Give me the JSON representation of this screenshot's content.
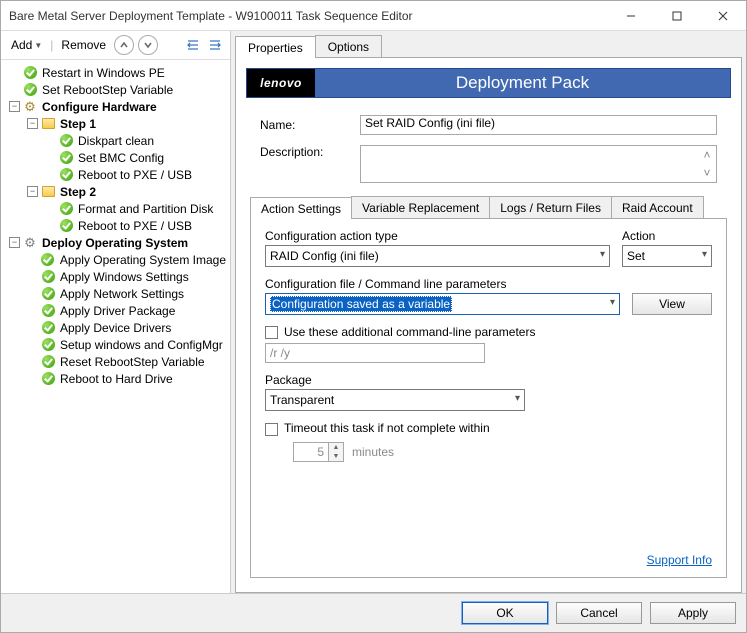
{
  "window": {
    "title": "Bare Metal Server Deployment Template - W9100011 Task Sequence Editor"
  },
  "toolbar": {
    "add": "Add",
    "remove": "Remove"
  },
  "tree": [
    {
      "indent": 0,
      "icon": "check",
      "label": "Restart in Windows PE"
    },
    {
      "indent": 0,
      "icon": "check",
      "label": "Set RebootStep Variable"
    },
    {
      "indent": 0,
      "icon": "gear",
      "label": "Configure Hardware",
      "bold": true,
      "toggle": "-"
    },
    {
      "indent": 1,
      "icon": "folder",
      "label": "Step 1",
      "bold": true,
      "toggle": "-"
    },
    {
      "indent": 2,
      "icon": "check",
      "label": "Diskpart clean"
    },
    {
      "indent": 2,
      "icon": "check",
      "label": "Set BMC Config"
    },
    {
      "indent": 2,
      "icon": "check",
      "label": "Reboot to PXE / USB"
    },
    {
      "indent": 1,
      "icon": "folder",
      "label": "Step 2",
      "bold": true,
      "toggle": "-"
    },
    {
      "indent": 2,
      "icon": "check",
      "label": "Format and Partition Disk"
    },
    {
      "indent": 2,
      "icon": "check",
      "label": "Reboot to PXE / USB"
    },
    {
      "indent": 0,
      "icon": "cog",
      "label": "Deploy Operating System",
      "bold": true,
      "toggle": "-"
    },
    {
      "indent": 1,
      "icon": "check",
      "label": "Apply Operating System Image"
    },
    {
      "indent": 1,
      "icon": "check",
      "label": "Apply Windows Settings"
    },
    {
      "indent": 1,
      "icon": "check",
      "label": "Apply Network Settings"
    },
    {
      "indent": 1,
      "icon": "check",
      "label": "Apply Driver Package"
    },
    {
      "indent": 1,
      "icon": "check",
      "label": "Apply Device Drivers"
    },
    {
      "indent": 1,
      "icon": "check",
      "label": "Setup windows and ConfigMgr"
    },
    {
      "indent": 1,
      "icon": "check",
      "label": "Reset RebootStep Variable"
    },
    {
      "indent": 1,
      "icon": "check",
      "label": "Reboot to Hard Drive"
    }
  ],
  "topTabs": {
    "properties": "Properties",
    "options": "Options"
  },
  "banner": {
    "logo": "lenovo",
    "title": "Deployment Pack"
  },
  "form": {
    "name_label": "Name:",
    "name_value": "Set RAID Config (ini file)",
    "desc_label": "Description:",
    "desc_value": ""
  },
  "subTabs": {
    "action": "Action Settings",
    "variable": "Variable Replacement",
    "logs": "Logs / Return Files",
    "raid": "Raid Account"
  },
  "actionSettings": {
    "config_type_label": "Configuration action type",
    "config_type_value": "RAID Config (ini file)",
    "action_label": "Action",
    "action_value": "Set",
    "config_file_label": "Configuration file / Command line parameters",
    "config_file_value": "Configuration saved as a variable",
    "view_btn": "View",
    "additional_params_label": "Use these additional command-line parameters",
    "additional_params_value": "/r /y",
    "package_label": "Package",
    "package_value": "Transparent",
    "timeout_label": "Timeout this task if not complete within",
    "timeout_value": "5",
    "timeout_unit": "minutes",
    "support_link": "Support Info"
  },
  "footer": {
    "ok": "OK",
    "cancel": "Cancel",
    "apply": "Apply"
  }
}
